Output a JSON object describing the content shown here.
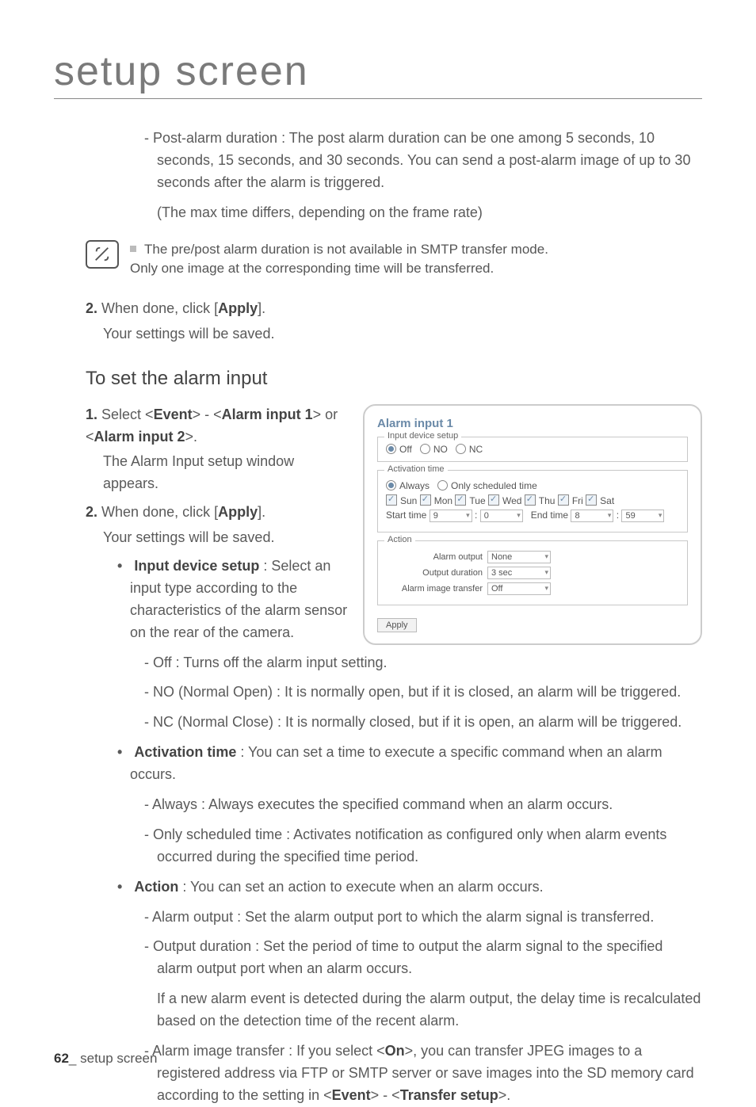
{
  "chapter": "setup screen",
  "postAlarm": {
    "li": "Post-alarm duration : The post alarm duration can be one among 5 seconds, 10 seconds, 15 seconds, and 30 seconds. You can send a post-alarm image of up to 30 seconds after the alarm is triggered.",
    "sub": "(The max time differs, depending on the frame rate)"
  },
  "note": {
    "l1": "The pre/post alarm duration is not available in SMTP transfer mode.",
    "l2": "Only one image at the corresponding time will be transferred."
  },
  "step2a": {
    "num": "2.",
    "t1": "When done, click [",
    "btn": "Apply",
    "t2": "].",
    "sub": "Your settings will be saved."
  },
  "h2": "To set the alarm input",
  "step1": {
    "num": "1.",
    "t1": "Select <",
    "ev": "Event",
    "t2": "> - <",
    "ai1": "Alarm input 1",
    "t3": "> or <",
    "ai2": "Alarm input 2",
    "t4": ">.",
    "sub": "The Alarm Input setup window appears."
  },
  "step2b": {
    "num": "2.",
    "t1": "When done, click [",
    "btn": "Apply",
    "t2": "].",
    "sub": "Your settings will be saved."
  },
  "ids": {
    "heading": "Input device setup",
    "t1": " : Select an input type according to the characteristics of the alarm sensor on the rear of the camera.",
    "off": "Off : Turns off the alarm input setting.",
    "no": "NO (Normal Open) : It is normally open, but if it is closed, an alarm will be triggered.",
    "nc": "NC (Normal Close) : It is normally closed, but if it is open, an alarm will be triggered."
  },
  "act": {
    "heading": "Activation time",
    "t1": " : You can set a time to execute a specific command when an alarm occurs.",
    "always": "Always : Always executes the specified command when an alarm occurs.",
    "sched": "Only scheduled time : Activates notification as configured only when alarm events occurred during the specified time period."
  },
  "action": {
    "heading": "Action",
    "t1": " : You can set an action to execute when an alarm occurs.",
    "out": "Alarm output : Set the alarm output port to which the alarm signal is transferred.",
    "dur": "Output duration : Set the period of time to output the alarm signal to the specified alarm output port when an alarm occurs.",
    "dur2": "If a new alarm event is detected during the alarm output, the delay time is recalculated based on the detection time of the recent alarm.",
    "xfer_a": "Alarm image transfer : If you select <",
    "on": "On",
    "xfer_b": ">, you can transfer JPEG images to a registered address via FTP or SMTP server or save images into the SD memory card according to the setting in <",
    "ev": "Event",
    "xfer_c": "> - <",
    "ts": "Transfer setup",
    "xfer_d": ">."
  },
  "shot": {
    "title": "Alarm input 1",
    "f1": "Input device setup",
    "off": "Off",
    "no": "NO",
    "nc": "NC",
    "f2": "Activation time",
    "always": "Always",
    "sched": "Only scheduled time",
    "days": {
      "sun": "Sun",
      "mon": "Mon",
      "tue": "Tue",
      "wed": "Wed",
      "thu": "Thu",
      "fri": "Fri",
      "sat": "Sat"
    },
    "start": "Start time",
    "end": "End time",
    "h1": "9",
    "m1": "0",
    "h2": "8",
    "m2": "59",
    "f3": "Action",
    "alarmOut": "Alarm output",
    "alarmOutV": "None",
    "outDur": "Output duration",
    "outDurV": "3 sec",
    "imgXfer": "Alarm image transfer",
    "imgXferV": "Off",
    "apply": "Apply"
  },
  "footer": {
    "num": "62",
    "sep": "_",
    "text": " setup screen"
  }
}
